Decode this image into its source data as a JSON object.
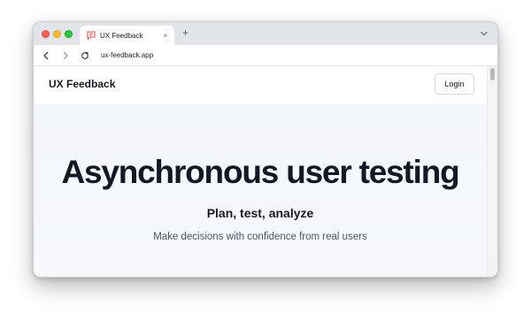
{
  "browser": {
    "tab": {
      "title": "UX Feedback",
      "close_glyph": "×",
      "favicon": "ux-feedback-logo-icon"
    },
    "new_tab_glyph": "+",
    "url": "ux-feedback.app",
    "icons": {
      "back": "back-arrow-icon",
      "forward": "forward-arrow-icon",
      "reload": "reload-icon",
      "tab_search": "chevron-down-icon"
    }
  },
  "site": {
    "brand": "UX Feedback",
    "login_label": "Login"
  },
  "hero": {
    "title": "Asynchronous user testing",
    "subtitle": "Plan, test, analyze",
    "tagline": "Make decisions with confidence from real users"
  },
  "colors": {
    "accent_favicon": "#e0524a",
    "heading": "#121826",
    "muted_text": "#4b5563"
  }
}
